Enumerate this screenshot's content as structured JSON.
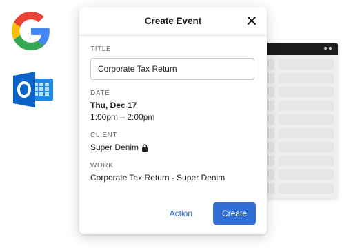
{
  "modal": {
    "title": "Create Event",
    "close_icon": "close-icon",
    "fields": {
      "title_label": "TITLE",
      "title_value": "Corporate Tax Return",
      "date_label": "DATE",
      "date_day": "Thu, Dec 17",
      "date_time": "1:00pm – 2:00pm",
      "client_label": "CLIENT",
      "client_value": "Super Denim",
      "client_icon": "lock-icon",
      "work_label": "WORK",
      "work_value": "Corporate Tax Return - Super Denim"
    },
    "actions": {
      "action_label": "Action",
      "create_label": "Create"
    }
  },
  "integrations": {
    "google_icon": "google-icon",
    "outlook_icon": "outlook-icon"
  },
  "colors": {
    "accent": "#2f6fd6",
    "google_blue": "#4285F4",
    "google_red": "#EA4335",
    "google_yellow": "#FBBC05",
    "google_green": "#34A853",
    "outlook_blue": "#0A64C8"
  }
}
